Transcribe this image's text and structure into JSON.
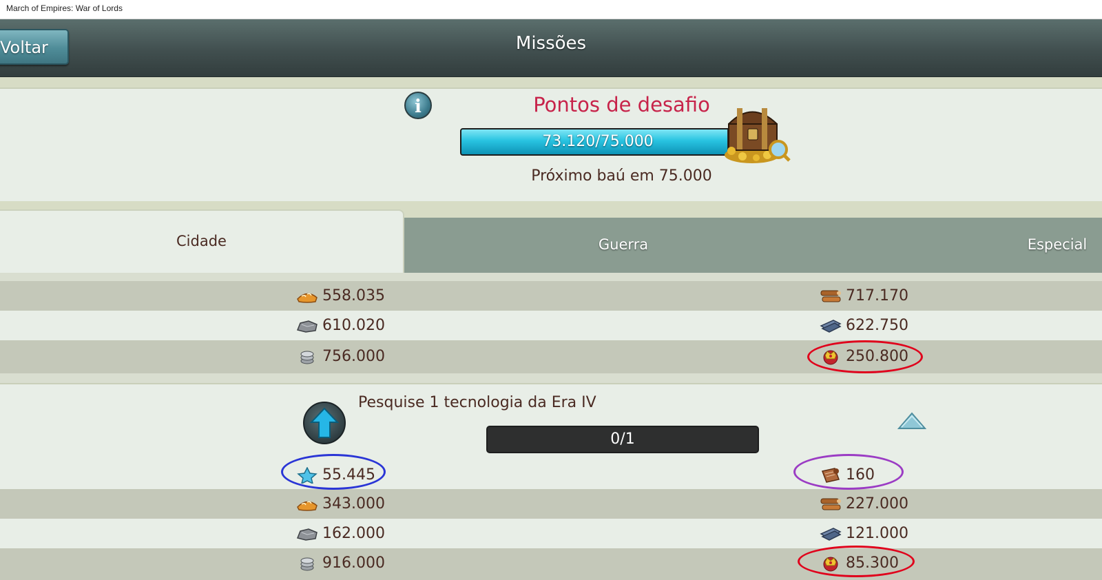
{
  "window": {
    "title": "March of Empires: War of Lords"
  },
  "header": {
    "back_label": "Voltar",
    "title": "Missões"
  },
  "challenge": {
    "title": "Pontos de desafio",
    "progress_text": "73.120/75.000",
    "progress_fraction": 0.975,
    "next_chest_text": "Próximo baú em 75.000",
    "info_icon": "info-icon",
    "chest_icon": "treasure-chest-icon"
  },
  "tabs": [
    {
      "label": "Cidade",
      "active": true
    },
    {
      "label": "Guerra",
      "active": false
    },
    {
      "label": "Especial",
      "active": false
    }
  ],
  "rewards_top": [
    {
      "left": {
        "icon": "food-icon",
        "value": "558.035"
      },
      "right": {
        "icon": "wood-icon",
        "value": "717.170"
      }
    },
    {
      "left": {
        "icon": "stone-icon",
        "value": "610.020"
      },
      "right": {
        "icon": "iron-icon",
        "value": "622.750"
      }
    },
    {
      "left": {
        "icon": "silver-icon",
        "value": "756.000"
      },
      "right": {
        "icon": "crown-icon",
        "value": "250.800"
      }
    }
  ],
  "mission": {
    "text": "Pesquise 1 tecnologia da Era IV",
    "progress_text": "0/1",
    "icon": "upgrade-arrow-icon",
    "collapse_icon": "chevron-up-icon"
  },
  "rewards_mission": [
    {
      "left": {
        "icon": "star-icon",
        "value": "55.445"
      },
      "right": {
        "icon": "scroll-icon",
        "value": "160"
      }
    },
    {
      "left": {
        "icon": "food-icon",
        "value": "343.000"
      },
      "right": {
        "icon": "wood-icon",
        "value": "227.000"
      }
    },
    {
      "left": {
        "icon": "stone-icon",
        "value": "162.000"
      },
      "right": {
        "icon": "iron-icon",
        "value": "121.000"
      }
    },
    {
      "left": {
        "icon": "silver-icon",
        "value": "916.000"
      },
      "right": {
        "icon": "crown-icon",
        "value": "85.300"
      }
    }
  ],
  "colors": {
    "header": "#414f4f",
    "accent_title": "#c7234a",
    "progress_fill": "#28c3e1",
    "annotation_red": "#e0001b",
    "annotation_blue": "#2a35d6",
    "annotation_purple": "#9b3cc4"
  }
}
